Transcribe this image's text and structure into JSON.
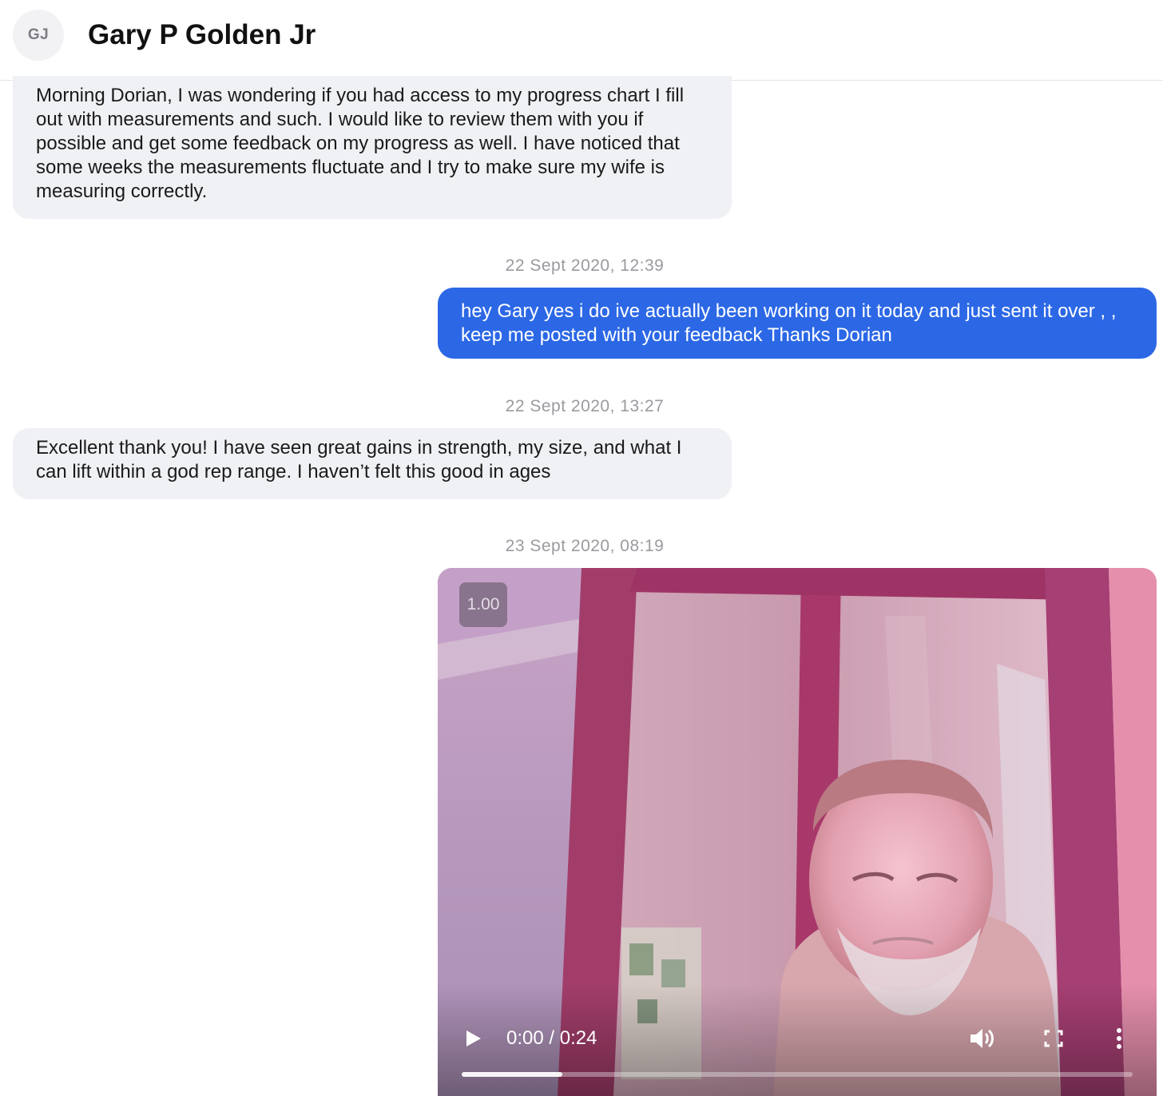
{
  "header": {
    "avatar_initials": "GJ",
    "contact_name": "Gary P Golden Jr"
  },
  "messages": [
    {
      "direction": "incoming",
      "text": "Morning Dorian, I was wondering if you had access to my progress chart I fill out with measurements and such. I would like to review them with you if possible and get some feedback on my progress as well. I have noticed that some weeks the measurements fluctuate and I try to make sure my wife is measuring correctly."
    },
    {
      "timestamp": "22 Sept 2020, 12:39",
      "direction": "outgoing",
      "text": "hey Gary yes i do ive actually been working on it today and just sent it over , , keep me posted with your feedback Thanks Dorian"
    },
    {
      "timestamp": "22 Sept 2020, 13:27",
      "direction": "incoming",
      "text": "Excellent thank you! I have seen great gains in strength, my size, and what I can lift within a god rep range. I haven’t felt this good in ages"
    },
    {
      "timestamp": "23 Sept 2020, 08:19",
      "direction": "outgoing",
      "type": "video"
    }
  ],
  "video": {
    "speed_label": "1.00",
    "time_display": "0:00 / 0:24",
    "progress_fraction": 0.15,
    "icons": {
      "play": "play-icon",
      "volume": "volume-icon",
      "fullscreen": "fullscreen-icon",
      "more": "more-options-icon"
    }
  },
  "colors": {
    "outgoing_bubble": "#2c68e6",
    "incoming_bubble": "#f0f1f4",
    "timestamp_text": "#9a9aa0"
  }
}
